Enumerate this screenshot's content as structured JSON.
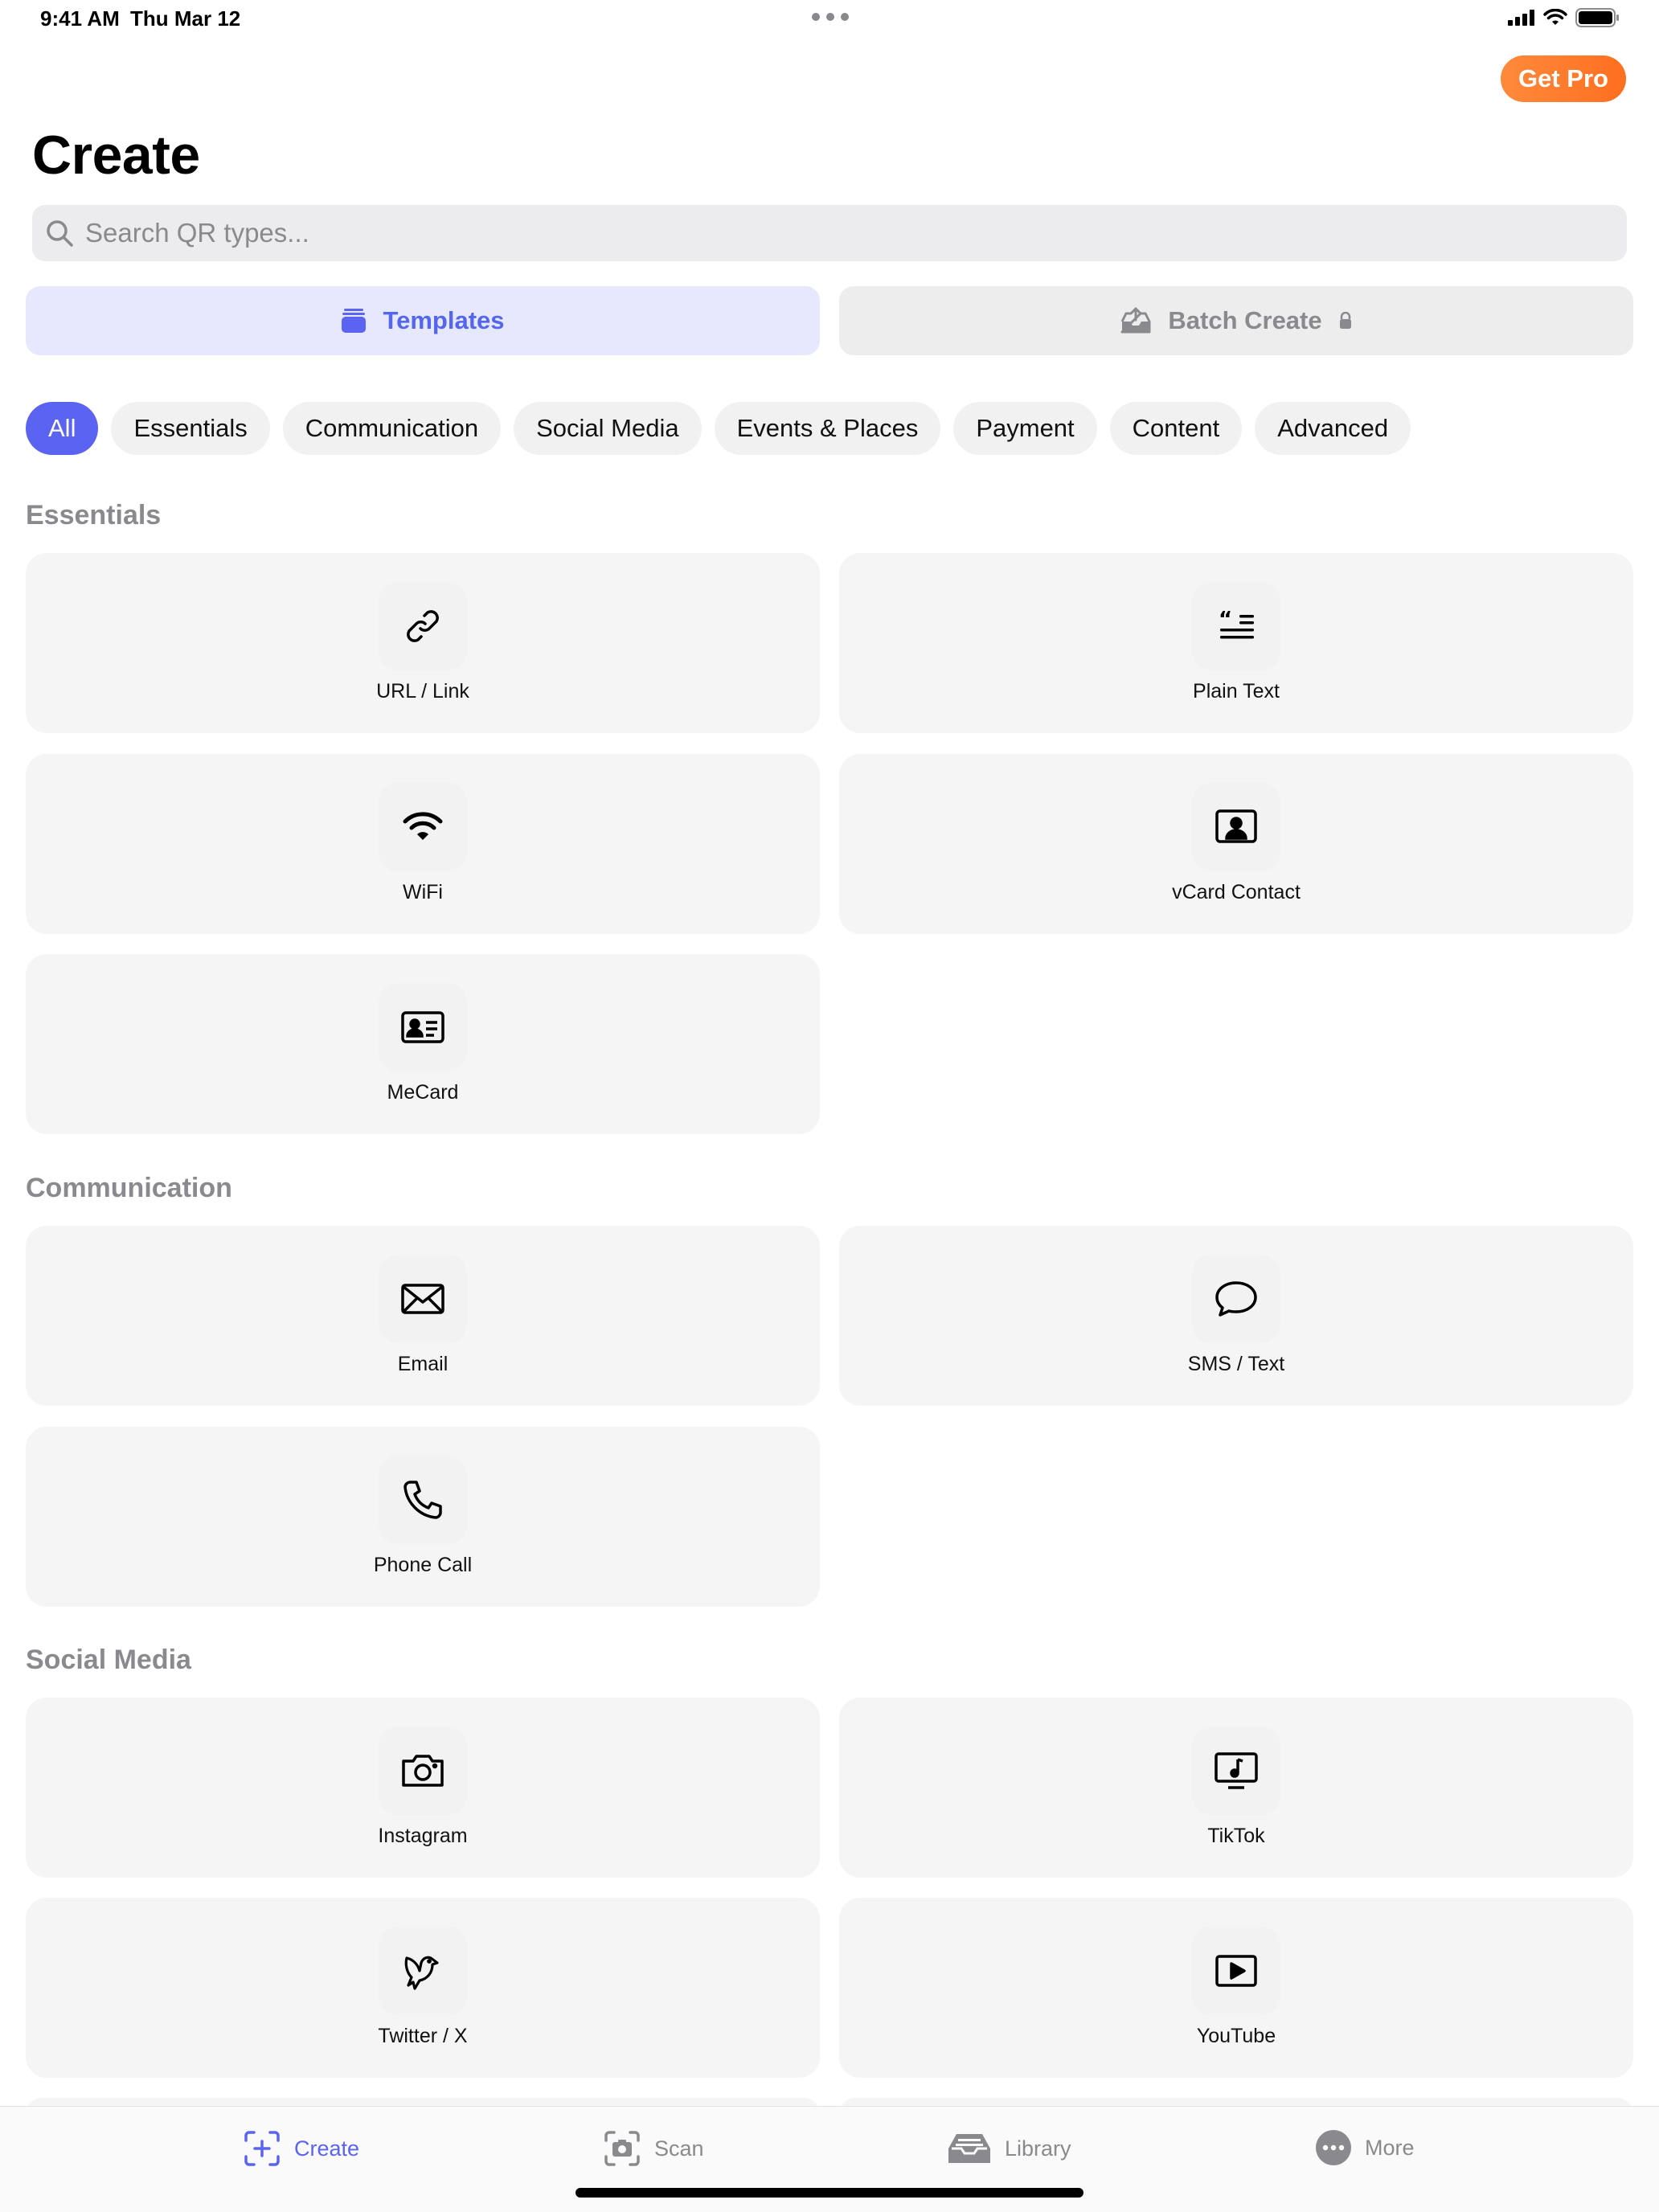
{
  "status": {
    "time": "9:41 AM",
    "date": "Thu Mar 12"
  },
  "header": {
    "pro_button": "Get Pro",
    "title": "Create"
  },
  "search": {
    "placeholder": "Search QR types..."
  },
  "segments": {
    "templates": "Templates",
    "batch": "Batch Create"
  },
  "chips": [
    "All",
    "Essentials",
    "Communication",
    "Social Media",
    "Events & Places",
    "Payment",
    "Content",
    "Advanced"
  ],
  "sections": {
    "essentials": {
      "title": "Essentials",
      "items": [
        {
          "label": "URL / Link",
          "icon": "link-icon"
        },
        {
          "label": "Plain Text",
          "icon": "text-quote-icon"
        },
        {
          "label": "WiFi",
          "icon": "wifi-icon"
        },
        {
          "label": "vCard Contact",
          "icon": "contact-icon"
        },
        {
          "label": "MeCard",
          "icon": "id-card-icon"
        }
      ]
    },
    "communication": {
      "title": "Communication",
      "items": [
        {
          "label": "Email",
          "icon": "envelope-icon"
        },
        {
          "label": "SMS / Text",
          "icon": "chat-bubble-icon"
        },
        {
          "label": "Phone Call",
          "icon": "phone-icon"
        }
      ]
    },
    "social": {
      "title": "Social Media",
      "items": [
        {
          "label": "Instagram",
          "icon": "camera-icon"
        },
        {
          "label": "TikTok",
          "icon": "music-tv-icon"
        },
        {
          "label": "Twitter / X",
          "icon": "bird-icon"
        },
        {
          "label": "YouTube",
          "icon": "play-rectangle-icon"
        }
      ]
    }
  },
  "tabs": {
    "create": "Create",
    "scan": "Scan",
    "library": "Library",
    "more": "More"
  },
  "colors": {
    "accent": "#5b64f0",
    "pro": "#ff7a2e",
    "card": "#f4f5f4"
  }
}
